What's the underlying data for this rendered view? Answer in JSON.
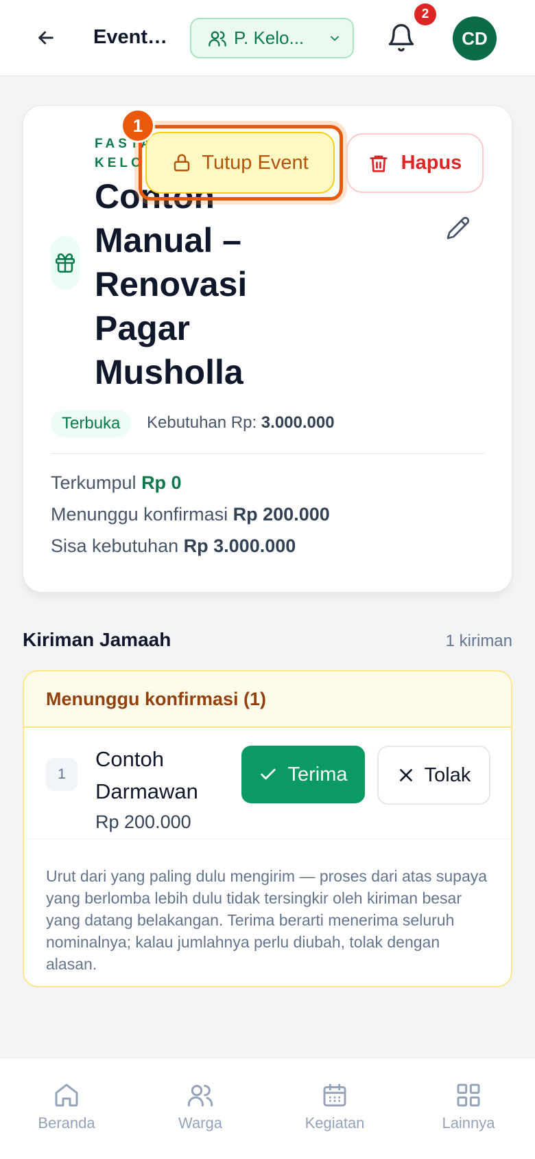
{
  "header": {
    "title": "Event ...",
    "group_selector": "P. Kelo...",
    "notification_count": "2",
    "avatar_initials": "CD"
  },
  "event": {
    "kicker_line1": "FASTA",
    "kicker_line2": "KELO",
    "title": "Contoh Manual – Renovasi Pagar Musholla",
    "status": "Terbuka",
    "need_label": "Kebutuhan Rp:",
    "need_value": "3.000.000",
    "collected_label": "Terkumpul",
    "collected_value": "Rp 0",
    "pending_label": "Menunggu konfirmasi",
    "pending_value": "Rp 200.000",
    "remaining_label": "Sisa kebutuhan",
    "remaining_value": "Rp 3.000.000"
  },
  "actions": {
    "close_event": "Tutup Event",
    "delete": "Hapus",
    "step_marker": "1"
  },
  "submissions": {
    "section_title": "Kiriman Jamaah",
    "count_label": "1 kiriman",
    "group_header": "Menunggu konfirmasi (1)",
    "items": [
      {
        "index": "1",
        "name": "Contoh Darmawan",
        "amount": "Rp 200.000",
        "accept_label": "Terima",
        "reject_label": "Tolak"
      }
    ],
    "note": "Urut dari yang paling dulu mengirim — proses dari atas supaya yang berlomba lebih dulu tidak tersingkir oleh kiriman besar yang datang belakangan. Terima berarti menerima seluruh nominalnya; kalau jumlahnya perlu diubah, tolak dengan alasan."
  },
  "nav": {
    "items": [
      {
        "label": "Beranda",
        "icon": "home-icon"
      },
      {
        "label": "Warga",
        "icon": "users-icon"
      },
      {
        "label": "Kegiatan",
        "icon": "calendar-icon"
      },
      {
        "label": "Lainnya",
        "icon": "grid-icon"
      }
    ]
  },
  "colors": {
    "brand_green": "#0b7a4b",
    "accept_green": "#0b9a63",
    "highlight_orange": "#ea580c",
    "danger_red": "#dc2626",
    "warning_amber": "#b45309"
  }
}
